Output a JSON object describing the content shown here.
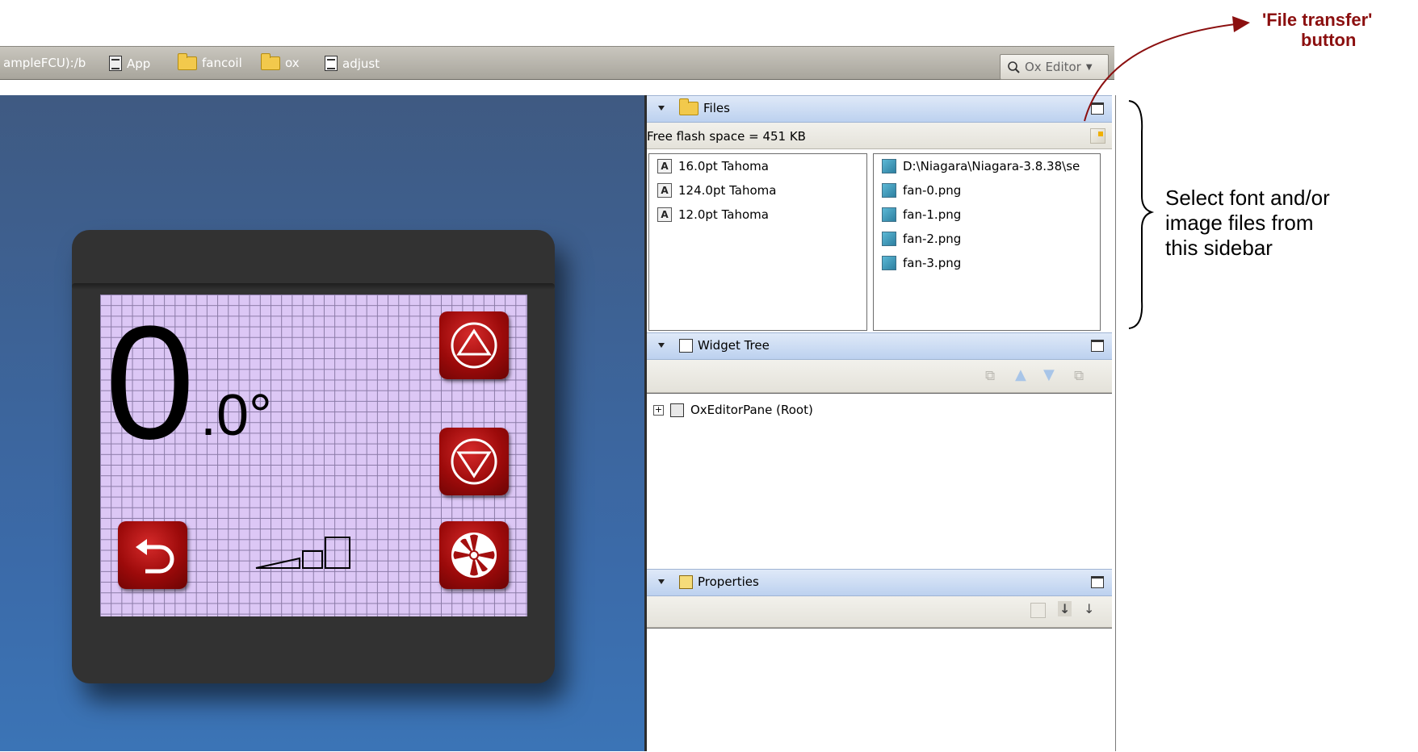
{
  "breadcrumb": {
    "path_prefix": "ampleFCU):/b",
    "items": [
      {
        "label": "App",
        "icon": "app-icon"
      },
      {
        "label": "fancoil",
        "icon": "folder-icon"
      },
      {
        "label": "ox",
        "icon": "folder-icon"
      },
      {
        "label": "adjust",
        "icon": "document-icon"
      }
    ]
  },
  "view_selector": {
    "label": "Ox Editor"
  },
  "device": {
    "temp_whole": "0",
    "temp_fraction": ".0°"
  },
  "files_panel": {
    "title": "Files",
    "free_space": "Free flash space = 451 KB",
    "fonts": [
      "16.0pt Tahoma",
      "124.0pt Tahoma",
      "12.0pt Tahoma"
    ],
    "images": [
      "D:\\Niagara\\Niagara-3.8.38\\se",
      "fan-0.png",
      "fan-1.png",
      "fan-2.png",
      "fan-3.png"
    ]
  },
  "widget_tree_panel": {
    "title": "Widget Tree",
    "root": "OxEditorPane (Root)"
  },
  "properties_panel": {
    "title": "Properties"
  },
  "annotations": {
    "file_transfer_line1": "'File transfer'",
    "file_transfer_line2": "button",
    "sidebar_note_line1": "Select font and/or",
    "sidebar_note_line2": "image files from",
    "sidebar_note_line3": "this sidebar"
  },
  "colors": {
    "annotation_red": "#8b0f0f",
    "screen_lilac": "#dcc7f5",
    "canvas_blue": "#3b6aa8",
    "button_red": "#b01616"
  }
}
